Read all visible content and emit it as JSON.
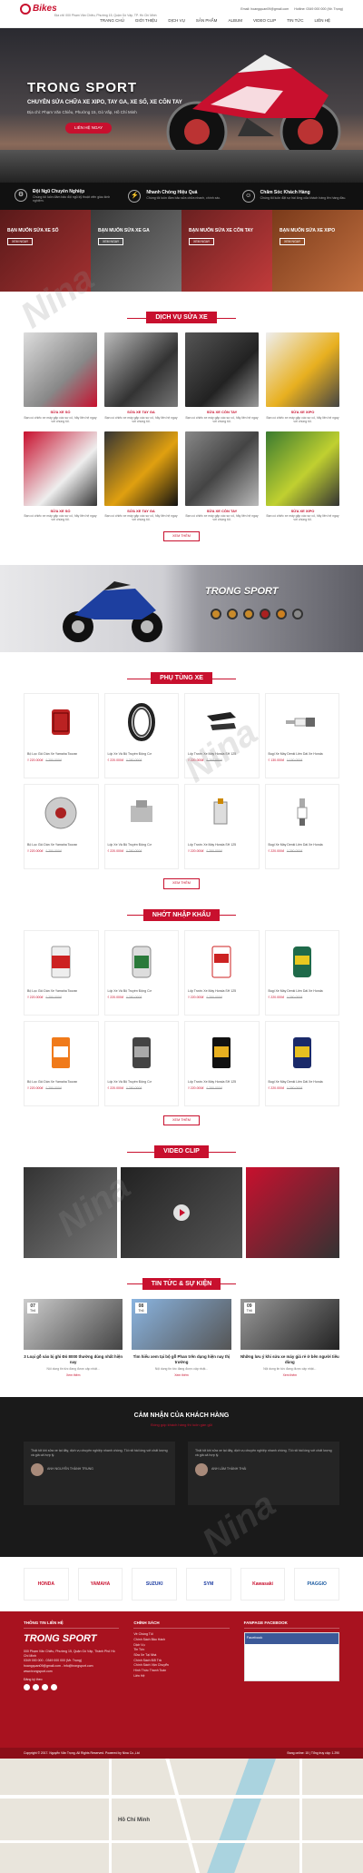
{
  "header": {
    "logo_text": "Bikes",
    "email": "Email: hoangquan09@gmail.com",
    "hotline": "Hotline: 0349 000 000 (Mr. Trọng)",
    "address": "Địa chỉ: 000 Phạm Văn Chiêu, Phường 15, Quận Gò Vấp, TP. Hồ Chí Minh"
  },
  "nav": [
    "Trang chủ",
    "Giới thiệu",
    "Dịch vụ",
    "Sản phẩm",
    "Album",
    "Video Clip",
    "Tin tức",
    "Liên hệ"
  ],
  "hero": {
    "title": "TRONG SPORT",
    "subtitle": "CHUYÊN SỬA CHỮA XE XIPO, TAY GA, XE SỐ, XE CÔN TAY",
    "address": "Địa chỉ: Phạm Văn Chiêu, Phường 15, Gò Vấp, Hồ Chí Minh",
    "button": "LIÊN HỆ NGAY"
  },
  "features": [
    {
      "icon": "⚙",
      "title": "Đội Ngũ Chuyên Nghiệp",
      "desc": "Chúng tôi luôn đảm bảo đội ngũ kỹ thuật viên giàu kinh nghiệm."
    },
    {
      "icon": "⚡",
      "title": "Nhanh Chóng Hiệu Quả",
      "desc": "Chúng tôi luôn đảm bảo sửa chữa nhanh, chính xác."
    },
    {
      "icon": "☺",
      "title": "Chăm Sóc Khách Hàng",
      "desc": "Chúng tôi luôn đặt sự hài lòng của khách hàng lên hàng đầu."
    }
  ],
  "promos": [
    {
      "title": "BẠN MUỐN SỬA XE SỐ",
      "button": "XEM NGAY"
    },
    {
      "title": "BẠN MUỐN SỬA XE GA",
      "button": "XEM NGAY"
    },
    {
      "title": "BẠN MUỐN SỬA XE CÔN TAY",
      "button": "XEM NGAY"
    },
    {
      "title": "BẠN MUỐN SỬA XE XIPO",
      "button": "XEM NGAY"
    }
  ],
  "services": {
    "title": "DỊCH VỤ SỬA XE",
    "more": "XEM THÊM",
    "items": [
      {
        "name": "SỬA XE SỐ",
        "desc": "Bạn có chiếc xe máy gặp các sự cố, hãy liên hệ ngay với chúng tôi."
      },
      {
        "name": "SỬA XE TAY GA",
        "desc": "Bạn có chiếc xe máy gặp các sự cố, hãy liên hệ ngay với chúng tôi."
      },
      {
        "name": "SỬA XE CÔN TAY",
        "desc": "Bạn có chiếc xe máy gặp các sự cố, hãy liên hệ ngay với chúng tôi."
      },
      {
        "name": "SỬA XE XIPO",
        "desc": "Bạn có chiếc xe máy gặp các sự cố, hãy liên hệ ngay với chúng tôi."
      },
      {
        "name": "SỬA XE SỐ",
        "desc": "Bạn có chiếc xe máy gặp các sự cố, hãy liên hệ ngay với chúng tôi."
      },
      {
        "name": "SỬA XE TAY GA",
        "desc": "Bạn có chiếc xe máy gặp các sự cố, hãy liên hệ ngay với chúng tôi."
      },
      {
        "name": "SỬA XE CÔN TAY",
        "desc": "Bạn có chiếc xe máy gặp các sự cố, hãy liên hệ ngay với chúng tôi."
      },
      {
        "name": "SỬA XE XIPO",
        "desc": "Bạn có chiếc xe máy gặp các sự cố, hãy liên hệ ngay với chúng tôi."
      }
    ]
  },
  "banner": {
    "title": "TRONG SPORT"
  },
  "parts": {
    "title": "PHỤ TÙNG XE",
    "more": "XEM THÊM",
    "items": [
      {
        "name": "Bộ Lọc Gió Dán Xe Yamaha Touran",
        "price": "₫ 220.000đ",
        "old": "₫ 250.000đ"
      },
      {
        "name": "Lốp Xe Và Bộ Truyền Động Cơ",
        "price": "₫ 220.000đ",
        "old": "₫ 250.000đ"
      },
      {
        "name": "Lốp Trước Xe Máy Honda SH 125",
        "price": "₫ 220.000đ",
        "old": "₫ 250.000đ"
      },
      {
        "name": "Bugi Xe Máy Denki Liền Dài Xe Honda",
        "price": "₫ 130.000đ",
        "old": "₫ 150.000đ"
      },
      {
        "name": "Bộ Lọc Gió Dán Xe Yamaha Touran",
        "price": "₫ 220.000đ",
        "old": "₫ 250.000đ"
      },
      {
        "name": "Lốp Xe Và Bộ Truyền Động Cơ",
        "price": "₫ 220.000đ",
        "old": "₫ 250.000đ"
      },
      {
        "name": "Lốp Trước Xe Máy Honda SH 125",
        "price": "₫ 220.000đ",
        "old": "₫ 250.000đ"
      },
      {
        "name": "Bugi Xe Máy Denki Liền Dài Xe Honda",
        "price": "₫ 220.000đ",
        "old": "₫ 250.000đ"
      }
    ]
  },
  "oils": {
    "title": "NHỚT NHẬP KHẨU",
    "more": "XEM THÊM",
    "items": [
      {
        "name": "Bộ Lọc Gió Dán Xe Yamaha Touran",
        "price": "₫ 220.000đ",
        "old": "₫ 250.000đ"
      },
      {
        "name": "Lốp Xe Và Bộ Truyền Động Cơ",
        "price": "₫ 220.000đ",
        "old": "₫ 250.000đ"
      },
      {
        "name": "Lốp Trước Xe Máy Honda SH 125",
        "price": "₫ 220.000đ",
        "old": "₫ 250.000đ"
      },
      {
        "name": "Bugi Xe Máy Denki Liền Dài Xe Honda",
        "price": "₫ 220.000đ",
        "old": "₫ 250.000đ"
      },
      {
        "name": "Bộ Lọc Gió Dán Xe Yamaha Touran",
        "price": "₫ 220.000đ",
        "old": "₫ 250.000đ"
      },
      {
        "name": "Lốp Xe Và Bộ Truyền Động Cơ",
        "price": "₫ 220.000đ",
        "old": "₫ 250.000đ"
      },
      {
        "name": "Lốp Trước Xe Máy Honda SH 125",
        "price": "₫ 220.000đ",
        "old": "₫ 250.000đ"
      },
      {
        "name": "Bugi Xe Máy Denki Liền Dài Xe Honda",
        "price": "₫ 220.000đ",
        "old": "₫ 250.000đ"
      }
    ]
  },
  "video": {
    "title": "VIDEO CLIP"
  },
  "news": {
    "title": "TIN TỨC & SỰ KIỆN",
    "items": [
      {
        "day": "07",
        "month": "Th6",
        "title": "3 Loại gỗ sáo bị ghi Đỏ 8000 thường dùng nhất hiện nay",
        "desc": "Nội dung tin tức đang được cập nhật...",
        "more": "Xem thêm"
      },
      {
        "day": "08",
        "month": "Th6",
        "title": "Tìm hiểu xem tại bộ gỗ Phan trên dụng hiện nay thị trường",
        "desc": "Nội dung tin tức đang được cập nhật...",
        "more": "Xem thêm"
      },
      {
        "day": "09",
        "month": "Th6",
        "title": "Những lưu ý khi sửa xe máy giá rẻ ở bên người tiêu dùng",
        "desc": "Nội dung tin tức đang được cập nhật...",
        "more": "Xem thêm"
      }
    ]
  },
  "testimonials": {
    "title": "CẢM NHẬN CỦA KHÁCH HÀNG",
    "subtitle": "Đóng góp khách hàng thì luôn gần gũi",
    "items": [
      {
        "text": "Thật tốt khi sửa xe tại đây, dịch vụ chuyên nghiệp nhanh chóng. Tôi rất hài lòng với chất lượng và giá cả hợp lý.",
        "name": "ANH NGUYỄN THÀNH TRUNG"
      },
      {
        "text": "Thật tốt khi sửa xe tại đây, dịch vụ chuyên nghiệp nhanh chóng. Tôi rất hài lòng với chất lượng và giá cả hợp lý.",
        "name": "ANH LÂM THÀNH THÁI"
      }
    ]
  },
  "brands": [
    "HONDA",
    "YAMAHA",
    "SUZUKI",
    "SYM",
    "Kawasaki",
    "PIAGGIO"
  ],
  "footer": {
    "contact_title": "THÔNG TIN LIÊN HỆ",
    "brand": "TRONG SPORT",
    "lines": [
      "000 Phạm Văn Chiêu, Phường 15, Quận Gò Vấp, Thành Phố Hồ Chí Minh",
      "0349 000 000 - 0349 000 000 (Mr. Trọng)",
      "hoangquan09@gmail.com - info@trongsport.com",
      "www.trongsport.com"
    ],
    "follow": "Đăng ký theo",
    "policy_title": "CHÍNH SÁCH",
    "policies": [
      "Về Chúng Tôi",
      "Chính Sách Bảo Hành",
      "Dịch Vụ",
      "Tin Tức",
      "Sửa Xe Tại Nhà",
      "Chính Sách Đổi Trả",
      "Chính Sách Vận Chuyển",
      "Hình Thức Thanh Toán",
      "Liên Hệ"
    ],
    "fanpage_title": "FANPAGE FACEBOOK",
    "fb_label": "Facebook",
    "copyright": "Copyright © 2017. Nguyễn Văn Trọng. All Rights Reserved. Powered by Nina Co.,Ltd",
    "stats": "Đang online: 15  |  Tổng truy cập: 1.290"
  },
  "map": {
    "city": "Hồ Chí Minh"
  }
}
